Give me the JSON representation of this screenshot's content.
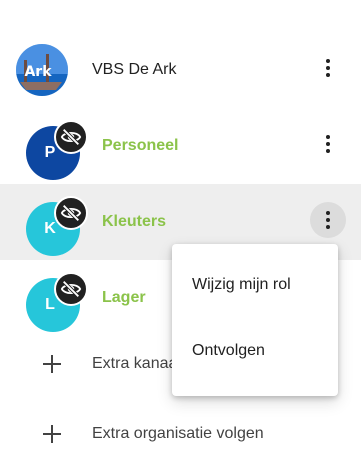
{
  "organization": {
    "name": "VBS De Ark",
    "logo_text": "Ark"
  },
  "groups": [
    {
      "name": "Personeel",
      "initial": "P",
      "avatar_color": "#0d47a1"
    },
    {
      "name": "Kleuters",
      "initial": "K",
      "avatar_color": "#26c6da"
    },
    {
      "name": "Lager",
      "initial": "L",
      "avatar_color": "#26c6da"
    }
  ],
  "add_group": {
    "label": "Extra kanaal volgen"
  },
  "add_org": {
    "label": "Extra organisatie volgen"
  },
  "context_menu": {
    "items": [
      {
        "label": "Wijzig mijn rol"
      },
      {
        "label": "Ontvolgen"
      }
    ]
  },
  "colors": {
    "group_label": "#8bc34a",
    "badge": "#212121",
    "active_row": "#eeeeee"
  },
  "icons": {
    "hidden_badge": "eye-off-icon",
    "more": "more-vert-icon",
    "add": "plus-icon"
  }
}
